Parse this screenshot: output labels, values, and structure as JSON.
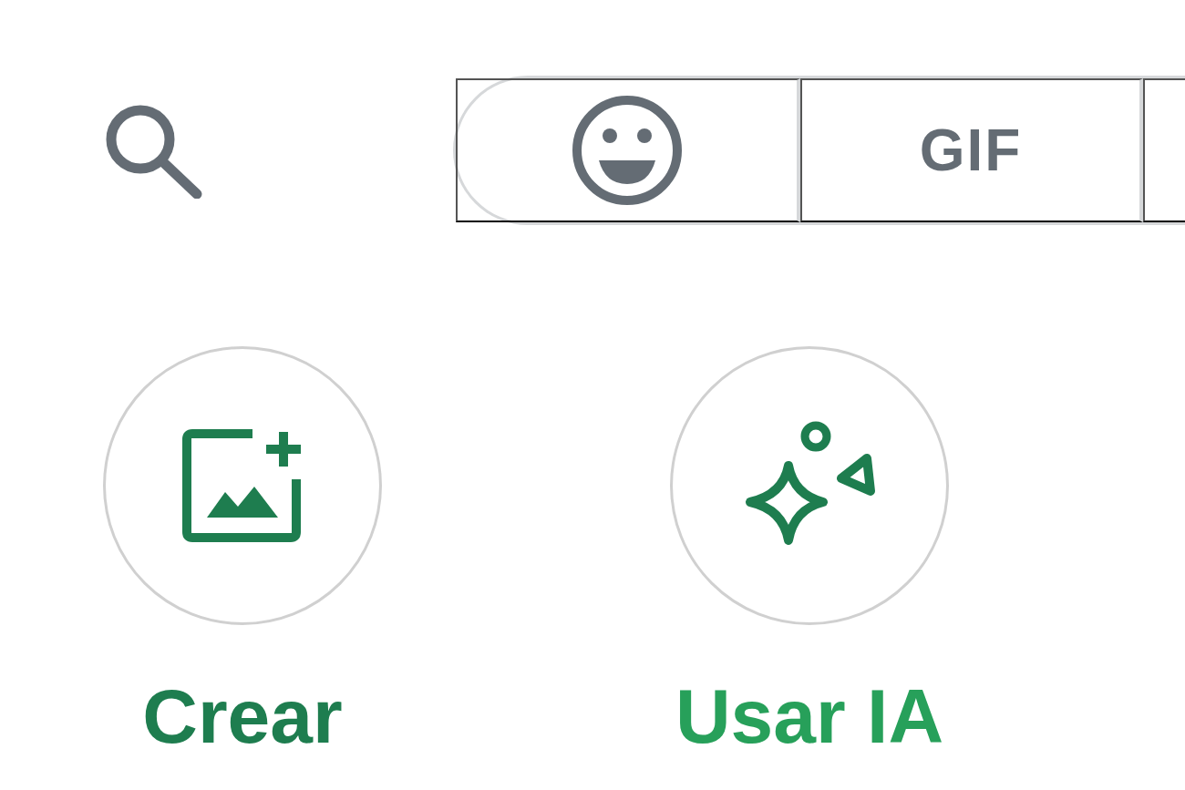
{
  "tabs": [
    {
      "kind": "emoji"
    },
    {
      "kind": "text",
      "label": "GIF"
    },
    {
      "kind": "blank"
    }
  ],
  "actions": [
    {
      "kind": "create-image",
      "label": "Crear",
      "color": "#1e7d4f"
    },
    {
      "kind": "ai",
      "label": "Usar IA",
      "color": "#27a05a"
    }
  ]
}
